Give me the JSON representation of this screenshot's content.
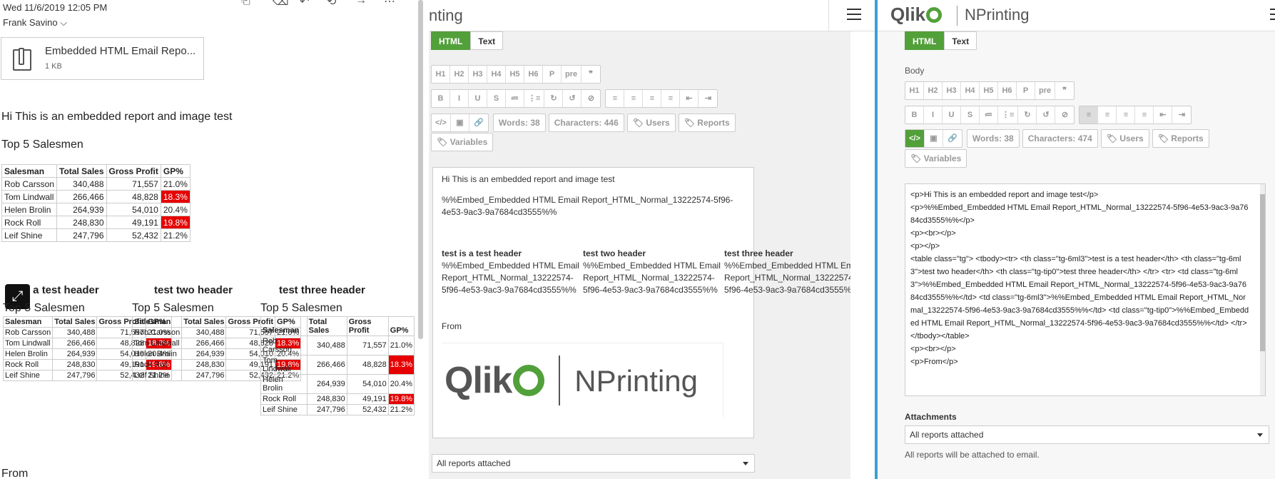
{
  "email": {
    "date": "Wed 11/6/2019 12:05 PM",
    "sender": "Frank Savino",
    "sender_chevron": "⌵",
    "attachment": {
      "name": "Embedded HTML Email Repo...",
      "size": "1 KB"
    },
    "greeting": "Hi This is an embedded report and image test",
    "top5_title": "Top 5 Salesmen",
    "from_label": "From",
    "headers": [
      "Salesman",
      "Total Sales",
      "Gross Profit",
      "GP%"
    ],
    "rows": [
      {
        "name": "Rob Carsson",
        "sales": "340,488",
        "profit": "71,557",
        "gp": "21.0%",
        "hi": false
      },
      {
        "name": "Tom Lindwall",
        "sales": "266,466",
        "profit": "48,828",
        "gp": "18.3%",
        "hi": true
      },
      {
        "name": "Helen Brolin",
        "sales": "264,939",
        "profit": "54,010",
        "gp": "20.4%",
        "hi": false
      },
      {
        "name": "Rock Roll",
        "sales": "248,830",
        "profit": "49,191",
        "gp": "19.8%",
        "hi": true
      },
      {
        "name": "Leif Shine",
        "sales": "247,796",
        "profit": "52,432",
        "gp": "21.2%",
        "hi": false
      }
    ],
    "col_headers": [
      "st is a test header",
      "test two header",
      "test three header"
    ],
    "mini_headers": [
      "Salesman",
      "Total Sales",
      "Gross Profit",
      "GP%"
    ],
    "expand_icon": "⤢"
  },
  "editor_mid": {
    "title_partial": "nting",
    "tabs": [
      "HTML",
      "Text"
    ],
    "heading_buttons": [
      "H1",
      "H2",
      "H3",
      "H4",
      "H5",
      "H6",
      "P",
      "pre",
      "❞"
    ],
    "format_buttons": [
      "B",
      "I",
      "U",
      "S",
      "≔",
      "⋮≡",
      "↻",
      "↺",
      "⊘"
    ],
    "align_buttons": [
      "≡",
      "≡",
      "≡",
      "≡",
      "⇤",
      "⇥"
    ],
    "code_buttons": [
      "</>",
      "▣",
      "🔗"
    ],
    "words": "Words: 38",
    "chars": "Characters: 446",
    "users": "Users",
    "reports": "Reports",
    "variables": "Variables",
    "preview": {
      "line1": "Hi This is an embedded report and image test",
      "line2": "%%Embed_Embedded HTML Email Report_HTML_Normal_13222574-5f96-4e53-9ac3-9a7684cd3555%%",
      "col_heads": [
        "test is a test header",
        "test two header",
        "test three header"
      ],
      "col_body": "%%Embed_Embedded HTML Email Report_HTML_Normal_13222574-5f96-4e53-9ac3-9a7684cd3555%%",
      "from": "From",
      "logo_qlik": "Qlik",
      "logo_nprinting": "NPrinting"
    },
    "attachments_value": "All reports attached"
  },
  "editor_right": {
    "logo_qlik": "Qlik",
    "logo_product": "NPrinting",
    "tabs": [
      "HTML",
      "Text"
    ],
    "body_label": "Body",
    "heading_buttons": [
      "H1",
      "H2",
      "H3",
      "H4",
      "H5",
      "H6",
      "P",
      "pre",
      "❞"
    ],
    "format_buttons": [
      "B",
      "I",
      "U",
      "S",
      "≔",
      "⋮≡",
      "↻",
      "↺",
      "⊘"
    ],
    "align_buttons": [
      "≡",
      "≡",
      "≡",
      "≡",
      "⇤",
      "⇥"
    ],
    "code_buttons": [
      "</>",
      "▣",
      "🔗"
    ],
    "words": "Words: 38",
    "chars": "Characters: 474",
    "users": "Users",
    "reports": "Reports",
    "variables": "Variables",
    "code_lines": [
      "<p>Hi This is an embedded report and image test</p>",
      "<p>%%Embed_Embedded HTML Email Report_HTML_Normal_13222574-5f96-4e53-9ac3-9a7684cd3555%%</p>",
      "<p><br></p>",
      "<p></p>",
      "<table class=\"tg\">  <tbody><tr>   <th class=\"tg-6ml3\">test is a test header</th>   <th class=\"tg-6ml3\">test two header</th>   <th class=\"tg-tip0\">test three header</th>  </tr>  <tr>   <td class=\"tg-6ml3\">%%Embed_Embedded HTML Email Report_HTML_Normal_13222574-5f96-4e53-9ac3-9a7684cd3555%%</td>   <td class=\"tg-6ml3\">%%Embed_Embedded HTML Email Report_HTML_Normal_13222574-5f96-4e53-9ac3-9a7684cd3555%%</td>   <td class=\"tg-tip0\">%%Embed_Embedded HTML Email Report_HTML_Normal_13222574-5f96-4e53-9ac3-9a7684cd3555%%</td>  </tr> </tbody></table>",
      "<p><br></p>",
      "<p>From</p>"
    ],
    "attachments_label": "Attachments",
    "attachments_value": "All reports attached",
    "attachments_note": "All reports will be attached to email."
  },
  "colors": {
    "accent": "#52a03a",
    "highlight": "#e60000",
    "divider": "#3aa0d8"
  }
}
